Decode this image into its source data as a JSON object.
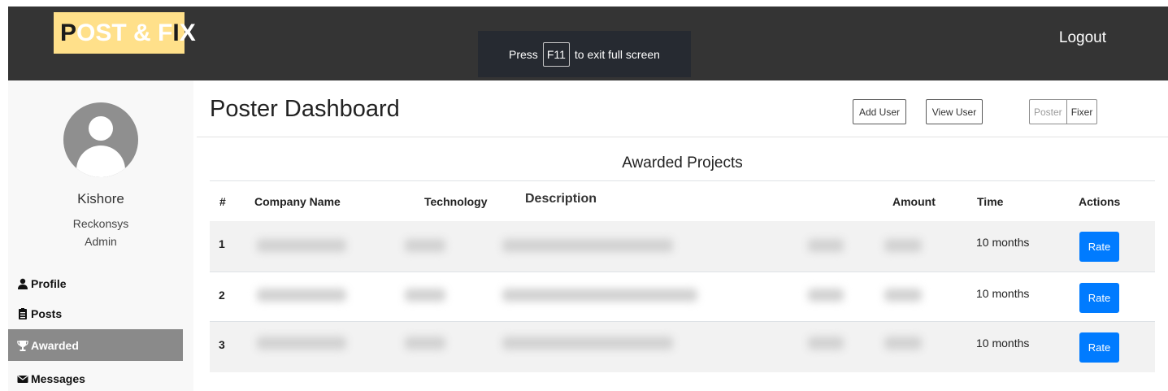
{
  "header": {
    "logo_part1": "P",
    "logo_part2": "OST & F",
    "logo_part3": "I",
    "logo_part4": "X",
    "logout": "Logout",
    "fullscreen_press": "Press",
    "fullscreen_key": "F11",
    "fullscreen_rest": "to exit full screen"
  },
  "sidebar": {
    "user_name": "Kishore",
    "org": "Reckonsys",
    "role": "Admin",
    "items": [
      {
        "label": "Profile",
        "icon": "user-icon"
      },
      {
        "label": "Posts",
        "icon": "clipboard-icon"
      },
      {
        "label": "Awarded",
        "icon": "trophy-icon"
      },
      {
        "label": "Messages",
        "icon": "envelope-icon"
      }
    ],
    "active_item": "Awarded"
  },
  "main": {
    "title": "Poster Dashboard",
    "add_user": "Add User",
    "view_user": "View User",
    "toggle_poster": "Poster",
    "toggle_fixer": "Fixer",
    "section_title": "Awarded Projects",
    "columns": [
      "#",
      "Company Name",
      "Technology",
      "Description",
      "Amount",
      "Time",
      "Actions"
    ],
    "rows": [
      {
        "index": "1",
        "time": "10 months",
        "action": "Rate"
      },
      {
        "index": "2",
        "time": "10 months",
        "action": "Rate"
      },
      {
        "index": "3",
        "time": "10 months",
        "action": "Rate"
      }
    ]
  },
  "colors": {
    "topbar": "#343434",
    "logo_bg": "#ffe08a",
    "active_nav": "#8a8a8a",
    "rate_button": "#007bff"
  }
}
